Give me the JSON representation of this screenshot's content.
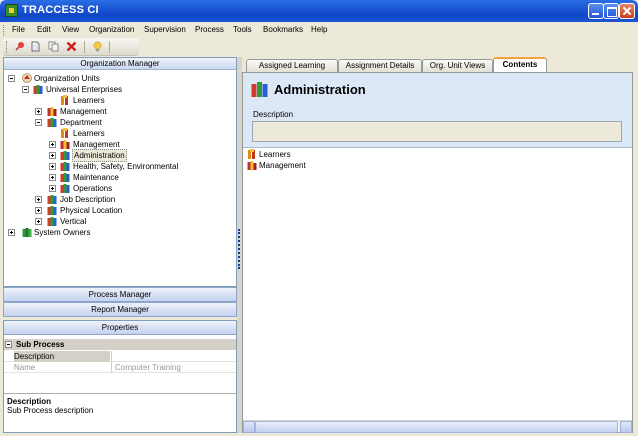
{
  "window": {
    "title": "TRACCESS CI"
  },
  "menu": [
    "File",
    "Edit",
    "View",
    "Organization",
    "Supervision",
    "Process",
    "Tools",
    "Bookmarks",
    "Help"
  ],
  "toolbar": {
    "icons": [
      "pin-icon",
      "document-icon",
      "copy-icon",
      "delete-icon",
      "lightbulb-icon"
    ]
  },
  "org_manager": {
    "title": "Organization Manager",
    "tree": [
      {
        "label": "Organization Units",
        "icon": "org-units-icon",
        "expander": "minus"
      },
      {
        "label": "Universal Enterprises",
        "icon": "books-icon",
        "expander": "minus"
      },
      {
        "label": "Learners",
        "icon": "learners-icon",
        "expander": "none"
      },
      {
        "label": "Management",
        "icon": "management-icon",
        "expander": "plus"
      },
      {
        "label": "Department",
        "icon": "books-icon",
        "expander": "minus"
      },
      {
        "label": "Learners",
        "icon": "learners-icon",
        "expander": "none"
      },
      {
        "label": "Management",
        "icon": "management-icon",
        "expander": "plus"
      },
      {
        "label": "Administration",
        "icon": "books-icon",
        "expander": "plus",
        "selected": true
      },
      {
        "label": "Health, Safety, Environmental",
        "icon": "books-icon",
        "expander": "plus"
      },
      {
        "label": "Maintenance",
        "icon": "books-icon",
        "expander": "plus"
      },
      {
        "label": "Operations",
        "icon": "books-icon",
        "expander": "plus"
      },
      {
        "label": "Job Description",
        "icon": "books-icon",
        "expander": "plus"
      },
      {
        "label": "Physical Location",
        "icon": "books-icon",
        "expander": "plus"
      },
      {
        "label": "Vertical",
        "icon": "books-icon",
        "expander": "plus"
      },
      {
        "label": "System Owners",
        "icon": "system-owners-icon",
        "expander": "plus"
      }
    ]
  },
  "process_manager": {
    "title": "Process Manager"
  },
  "report_manager": {
    "title": "Report Manager"
  },
  "properties": {
    "title": "Properties",
    "category": "Sub Process",
    "rows": [
      {
        "name": "Description",
        "value": ""
      },
      {
        "name": "Name",
        "value": "Computer Training"
      }
    ],
    "description_title": "Description",
    "description_text": "Sub Process description"
  },
  "tabs": [
    "Assigned Learning",
    "Assignment Details",
    "Org. Unit Views",
    "Contents"
  ],
  "active_tab": "Contents",
  "content": {
    "title": "Administration",
    "description_label": "Description",
    "description_value": "",
    "items": [
      {
        "label": "Learners",
        "icon": "learners-icon"
      },
      {
        "label": "Management",
        "icon": "management-icon"
      }
    ]
  },
  "colors": {
    "title_bar": "#0f46c7",
    "active_tab_accent": "#f2a33c",
    "content_header": "#dde8f6"
  }
}
